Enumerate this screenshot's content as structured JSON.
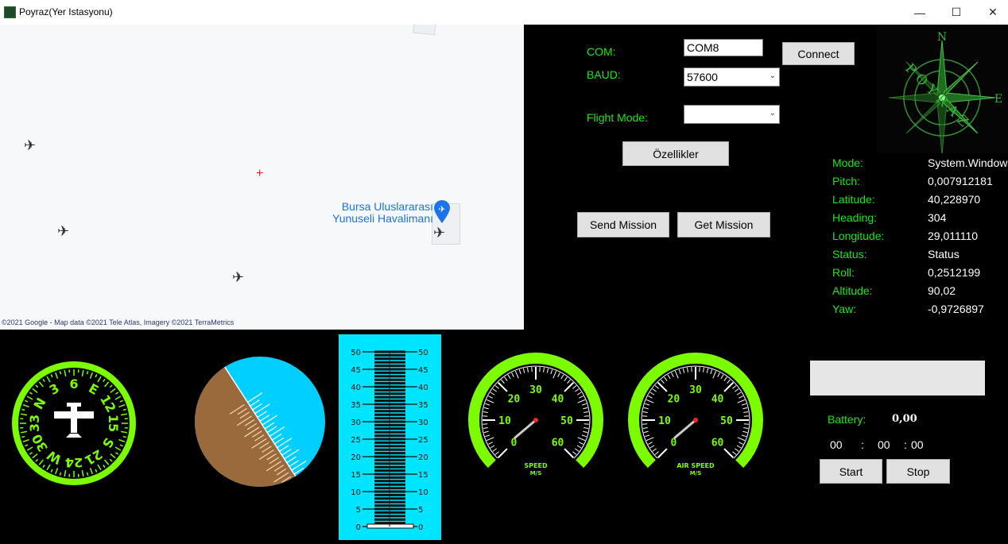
{
  "window": {
    "title": "Poyraz(Yer Istasyonu)",
    "minimize_glyph": "—",
    "maximize_glyph": "☐",
    "close_glyph": "✕"
  },
  "map": {
    "attribution": "©2021 Google - Map data ©2021 Tele Atlas, Imagery ©2021 TerraMetrics",
    "airport_line1": "Bursa Uluslararası",
    "airport_line2": "Yunuseli Havalimanı",
    "crosshair": "+"
  },
  "controls": {
    "com_label": "COM:",
    "com_value": "COM8",
    "baud_label": "BAUD:",
    "baud_value": "57600",
    "flight_mode_label": "Flight Mode:",
    "flight_mode_value": "",
    "connect_label": "Connect",
    "features_label": "Özellikler",
    "send_mission_label": "Send Mission",
    "get_mission_label": "Get Mission"
  },
  "logo": {
    "text": "POYRAZ",
    "north": "N",
    "east": "E"
  },
  "telemetry": [
    {
      "label": "Mode:",
      "value": "System.Windows"
    },
    {
      "label": "Pitch:",
      "value": "0,007912181"
    },
    {
      "label": "Latitude:",
      "value": "40,228970"
    },
    {
      "label": "Heading:",
      "value": "304"
    },
    {
      "label": "Longitude:",
      "value": "29,011110"
    },
    {
      "label": "Status:",
      "value": "Status"
    },
    {
      "label": "Roll:",
      "value": "0,2512199"
    },
    {
      "label": "Altitude:",
      "value": "90,02"
    },
    {
      "label": "Yaw:",
      "value": "-0,9726897"
    }
  ],
  "heading_indicator": {
    "labels": [
      "N",
      "3",
      "6",
      "E",
      "12",
      "15",
      "S",
      "21",
      "24",
      "W",
      "30",
      "33"
    ]
  },
  "altimeter": {
    "ticks": [
      "50",
      "45",
      "40",
      "35",
      "30",
      "25",
      "20",
      "15",
      "10",
      "5",
      "0"
    ]
  },
  "speed_gauge": {
    "labels": [
      "0",
      "10",
      "20",
      "30",
      "40",
      "50",
      "60"
    ],
    "caption1": "SPEED",
    "caption2": "M/S"
  },
  "airspeed_gauge": {
    "labels": [
      "0",
      "10",
      "20",
      "30",
      "40",
      "50",
      "60"
    ],
    "caption1": "AIR SPEED",
    "caption2": "M/S"
  },
  "battery": {
    "label": "Battery:",
    "value": "0,00"
  },
  "timer": {
    "hours": "00",
    "sep1": ":",
    "minutes": "00",
    "sep2": ":",
    "seconds": "00",
    "start_label": "Start",
    "stop_label": "Stop"
  },
  "colors": {
    "accent_green": "#19e619",
    "gauge_green": "#7cfc00",
    "sky": "#00cfff",
    "ground": "#9a6a3c",
    "alt_panel": "#00e5ff"
  }
}
